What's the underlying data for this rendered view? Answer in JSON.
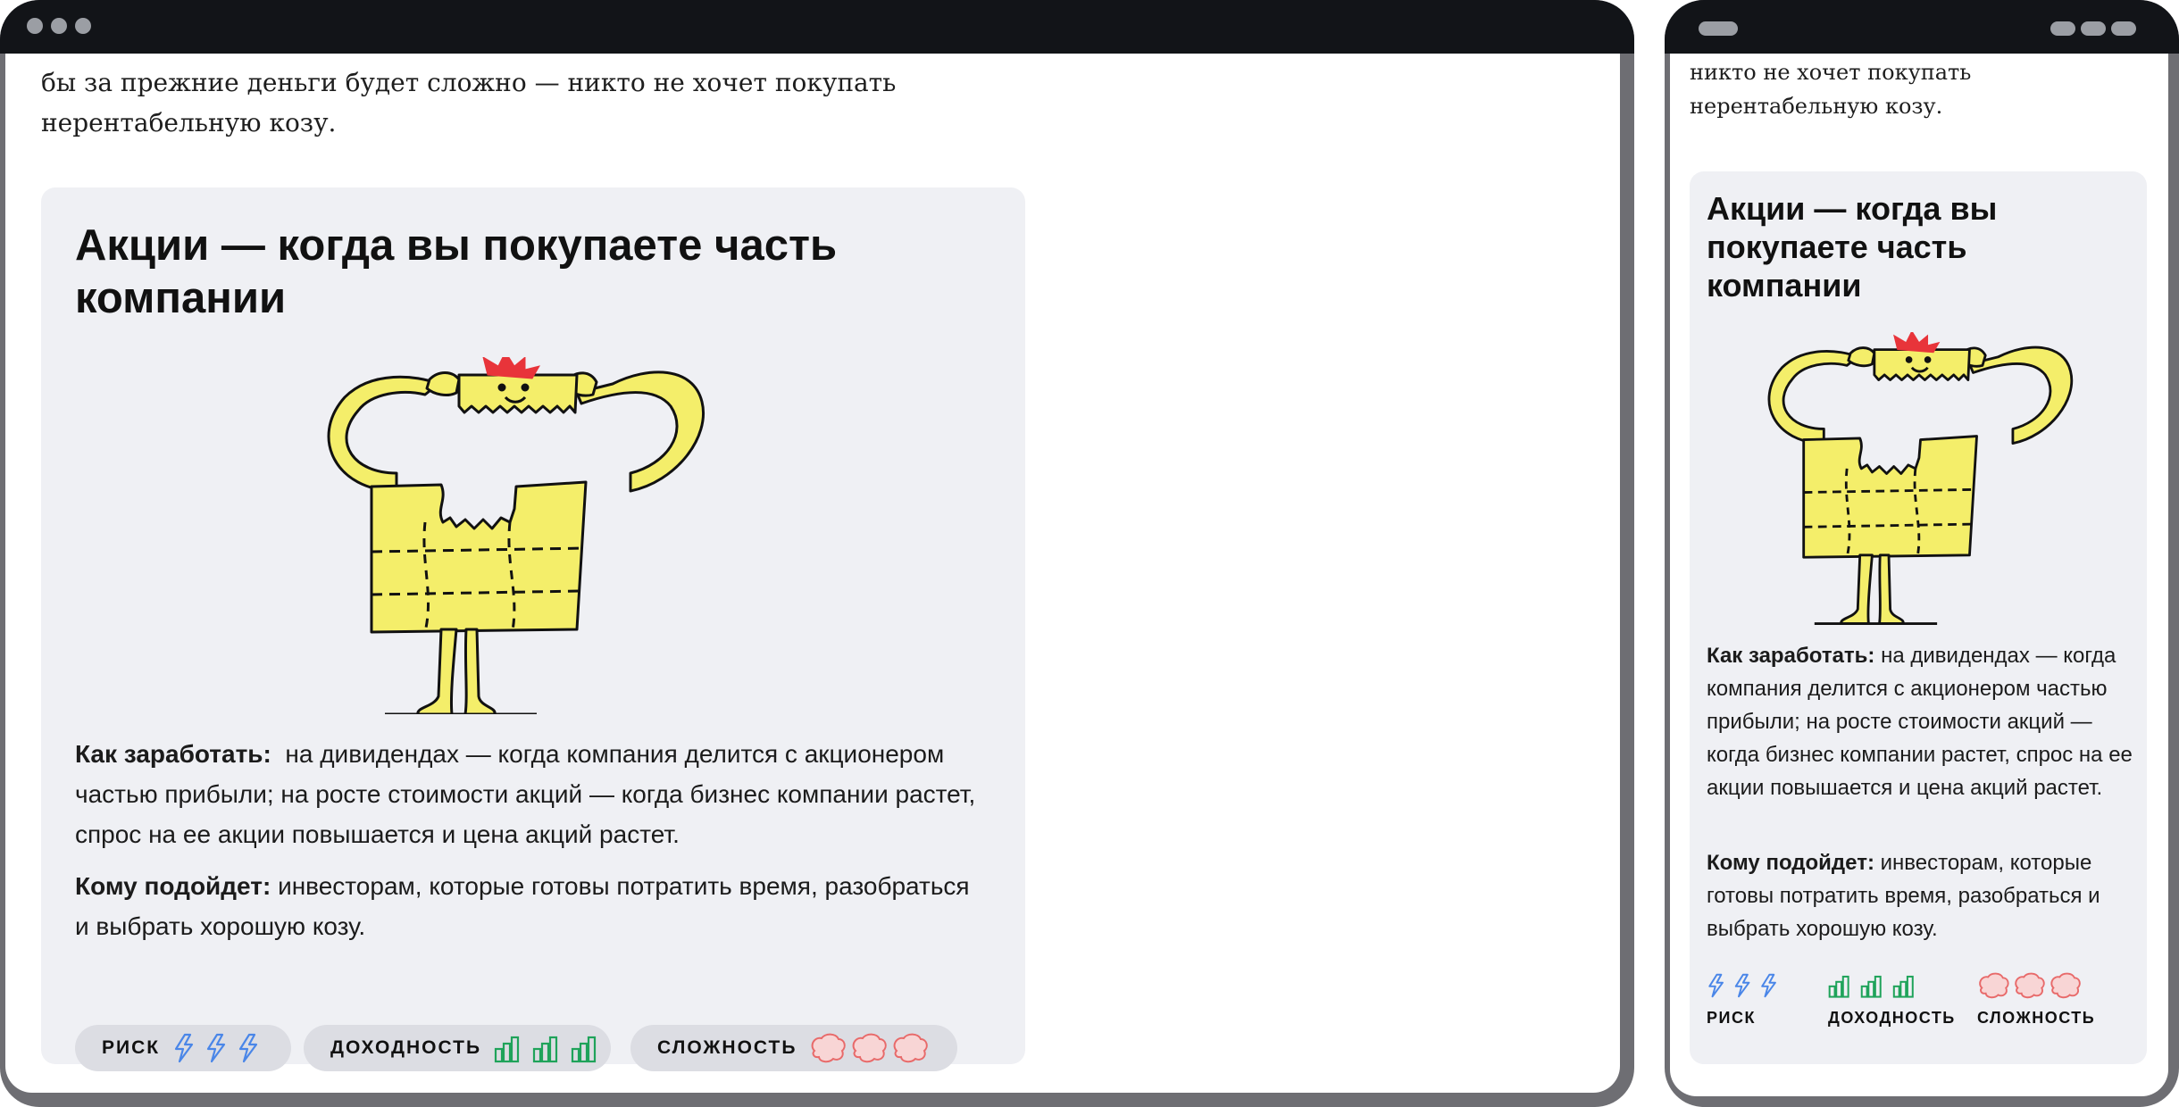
{
  "article": {
    "paragraph_desktop": "бы за прежние деньги будет сложно — никто не хочет покупать нерентабельную козу.",
    "paragraph_mobile": "никто не хочет покупать нерентабельную козу."
  },
  "card": {
    "title": "Акции — когда вы покупаете часть компании",
    "earn_label": "Как заработать:",
    "earn_text": "на дивидендах — когда компания делится с акционером частью прибыли; на росте стоимости акций — когда бизнес компании растет, спрос на ее акции повышается и цена акций растет.",
    "fit_label": "Кому подойдет:",
    "fit_text": "инвесторам, которые готовы потратить время, разобраться и выбрать хорошую козу."
  },
  "metrics": [
    {
      "label": "РИСК",
      "icon": "lightning-icon",
      "count": 3,
      "color": "#4a86e8"
    },
    {
      "label": "ДОХОДНОСТЬ",
      "icon": "bar-chart-icon",
      "count": 3,
      "color": "#1fa35a"
    },
    {
      "label": "СЛОЖНОСТЬ",
      "icon": "brain-icon",
      "count": 3,
      "color": "#e86a6a"
    }
  ],
  "colors": {
    "frame": "#6e6e73",
    "titlebar": "#121418",
    "card_bg": "#eff0f4",
    "chip_bg": "#dcdde3",
    "illustration_yellow": "#f4ee6a",
    "hair_red": "#e8343a"
  }
}
